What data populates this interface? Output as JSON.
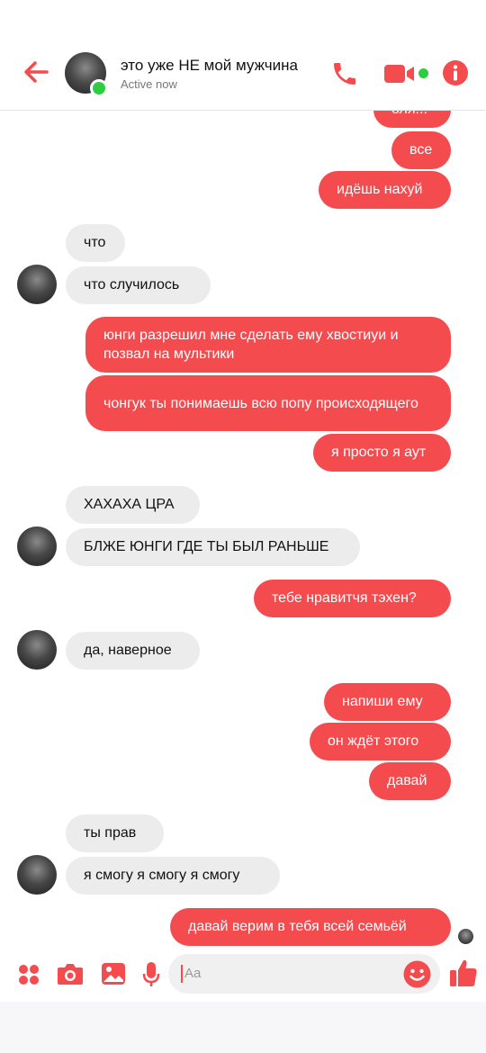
{
  "header": {
    "title": "это уже НЕ мой мужчина",
    "status": "Active now"
  },
  "messages": [
    {
      "from": "me",
      "text": "оля..."
    },
    {
      "from": "me",
      "text": "все"
    },
    {
      "from": "me",
      "text": "идёшь нахуй"
    },
    {
      "from": "them",
      "text": "что"
    },
    {
      "from": "them",
      "text": "что случилось"
    },
    {
      "from": "me",
      "text": "юнги разрешил мне сделать ему хвостиуи и позвал на мультики"
    },
    {
      "from": "me",
      "text": "чонгук ты понимаешь всю попу происходящего"
    },
    {
      "from": "me",
      "text": "я просто я аут"
    },
    {
      "from": "them",
      "text": "ХАХАХА ЦРА"
    },
    {
      "from": "them",
      "text": "БЛЖЕ ЮНГИ ГДЕ ТЫ БЫЛ РАНЬШЕ"
    },
    {
      "from": "me",
      "text": "тебе нравитчя тэхен?"
    },
    {
      "from": "them",
      "text": "да, наверное"
    },
    {
      "from": "me",
      "text": "напиши ему"
    },
    {
      "from": "me",
      "text": "он ждёт этого"
    },
    {
      "from": "me",
      "text": "давай"
    },
    {
      "from": "them",
      "text": "ты прав"
    },
    {
      "from": "them",
      "text": "я смогу я смогу я смогу"
    },
    {
      "from": "me",
      "text": "давай верим в тебя всей семьёй"
    }
  ],
  "composer": {
    "placeholder": "Aa"
  },
  "colors": {
    "accent": "#f44b4f",
    "incoming_bubble": "#ececec",
    "online": "#2ecc40"
  },
  "icons": [
    "back-arrow-icon",
    "phone-icon",
    "video-camera-icon",
    "info-icon",
    "apps-icon",
    "camera-icon",
    "gallery-icon",
    "microphone-icon",
    "emoji-icon",
    "thumbs-up-icon"
  ]
}
